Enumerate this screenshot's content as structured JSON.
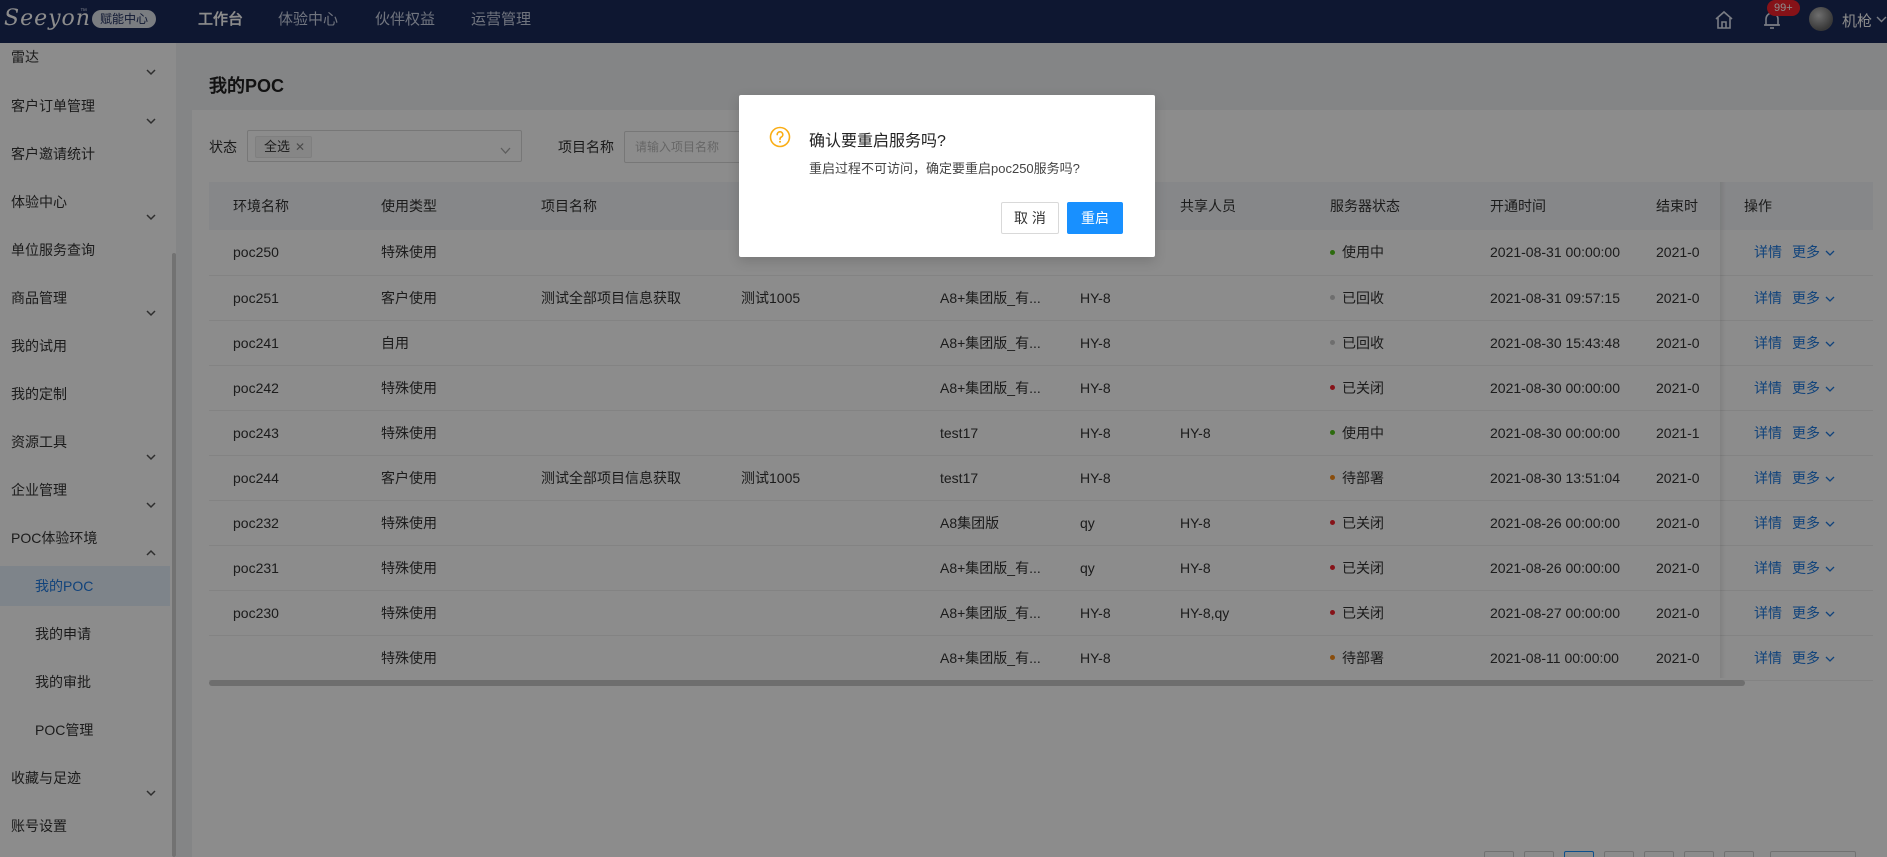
{
  "topbar": {
    "logo": "Seeyon",
    "logo_tm": "™",
    "brand_badge": "赋能中心",
    "nav": [
      "工作台",
      "体验中心",
      "伙伴权益",
      "运营管理"
    ],
    "notify_count": "99+",
    "username": "机枪",
    "bg_color": "#1b2a5a"
  },
  "sidebar": {
    "items": [
      {
        "label": "雷达",
        "arrow": "down"
      },
      {
        "label": "客户订单管理",
        "arrow": "down"
      },
      {
        "label": "客户邀请统计"
      },
      {
        "label": "体验中心",
        "arrow": "down"
      },
      {
        "label": "单位服务查询"
      },
      {
        "label": "商品管理",
        "arrow": "down"
      },
      {
        "label": "我的试用"
      },
      {
        "label": "我的定制"
      },
      {
        "label": "资源工具",
        "arrow": "down"
      },
      {
        "label": "企业管理",
        "arrow": "down"
      },
      {
        "label": "POC体验环境",
        "arrow": "up"
      },
      {
        "label": "我的POC",
        "sub": true,
        "active": true
      },
      {
        "label": "我的申请",
        "sub": true
      },
      {
        "label": "我的审批",
        "sub": true
      },
      {
        "label": "POC管理",
        "sub": true
      },
      {
        "label": "收藏与足迹",
        "arrow": "down"
      },
      {
        "label": "账号设置"
      }
    ]
  },
  "main": {
    "title": "我的POC",
    "filters": {
      "status_label": "状态",
      "status_tag": "全选",
      "project_label": "项目名称",
      "project_placeholder": "请输入项目名称"
    },
    "table": {
      "columns": [
        "环境名称",
        "使用类型",
        "项目名称",
        "",
        "",
        "",
        "共享人员",
        "服务器状态",
        "开通时间",
        "结束时",
        "操作"
      ],
      "op_detail": "详情",
      "op_more": "更多",
      "rows": [
        {
          "env": "poc250",
          "type": "特殊使用",
          "project": "",
          "customer": "",
          "version": "",
          "owner": "",
          "share": "",
          "status": "使用中",
          "status_color": "#52c41a",
          "open": "2021-08-31 00:00:00",
          "end": "2021-0"
        },
        {
          "env": "poc251",
          "type": "客户使用",
          "project": "测试全部项目信息获取",
          "customer": "测试1005",
          "version": "A8+集团版_有...",
          "owner": "HY-8",
          "share": "",
          "status": "已回收",
          "status_color": "#c8c8c8",
          "open": "2021-08-31 09:57:15",
          "end": "2021-0"
        },
        {
          "env": "poc241",
          "type": "自用",
          "project": "",
          "customer": "",
          "version": "A8+集团版_有...",
          "owner": "HY-8",
          "share": "",
          "status": "已回收",
          "status_color": "#c8c8c8",
          "open": "2021-08-30 15:43:48",
          "end": "2021-0"
        },
        {
          "env": "poc242",
          "type": "特殊使用",
          "project": "",
          "customer": "",
          "version": "A8+集团版_有...",
          "owner": "HY-8",
          "share": "",
          "status": "已关闭",
          "status_color": "#f5222d",
          "open": "2021-08-30 00:00:00",
          "end": "2021-0"
        },
        {
          "env": "poc243",
          "type": "特殊使用",
          "project": "",
          "customer": "",
          "version": "test17",
          "owner": "HY-8",
          "share": "HY-8",
          "status": "使用中",
          "status_color": "#52c41a",
          "open": "2021-08-30 00:00:00",
          "end": "2021-1"
        },
        {
          "env": "poc244",
          "type": "客户使用",
          "project": "测试全部项目信息获取",
          "customer": "测试1005",
          "version": "test17",
          "owner": "HY-8",
          "share": "",
          "status": "待部署",
          "status_color": "#fa8c16",
          "open": "2021-08-30 13:51:04",
          "end": "2021-0"
        },
        {
          "env": "poc232",
          "type": "特殊使用",
          "project": "",
          "customer": "",
          "version": "A8集团版",
          "owner": "qy",
          "share": "HY-8",
          "status": "已关闭",
          "status_color": "#f5222d",
          "open": "2021-08-26 00:00:00",
          "end": "2021-0"
        },
        {
          "env": "poc231",
          "type": "特殊使用",
          "project": "",
          "customer": "",
          "version": "A8+集团版_有...",
          "owner": "qy",
          "share": "HY-8",
          "status": "已关闭",
          "status_color": "#f5222d",
          "open": "2021-08-26 00:00:00",
          "end": "2021-0"
        },
        {
          "env": "poc230",
          "type": "特殊使用",
          "project": "",
          "customer": "",
          "version": "A8+集团版_有...",
          "owner": "HY-8",
          "share": "HY-8,qy",
          "status": "已关闭",
          "status_color": "#f5222d",
          "open": "2021-08-27 00:00:00",
          "end": "2021-0"
        },
        {
          "env": "",
          "type": "特殊使用",
          "project": "",
          "customer": "",
          "version": "A8+集团版_有...",
          "owner": "HY-8",
          "share": "",
          "status": "待部署",
          "status_color": "#fa8c16",
          "open": "2021-08-11 00:00:00",
          "end": "2021-0"
        }
      ]
    }
  },
  "modal": {
    "title": "确认要重启服务吗?",
    "content": "重启过程不可访问，确定要重启poc250服务吗?",
    "cancel_label": "取 消",
    "ok_label": "重启",
    "icon": "question-circle-icon",
    "accent_color": "#1890ff",
    "warning_color": "#faad14"
  }
}
